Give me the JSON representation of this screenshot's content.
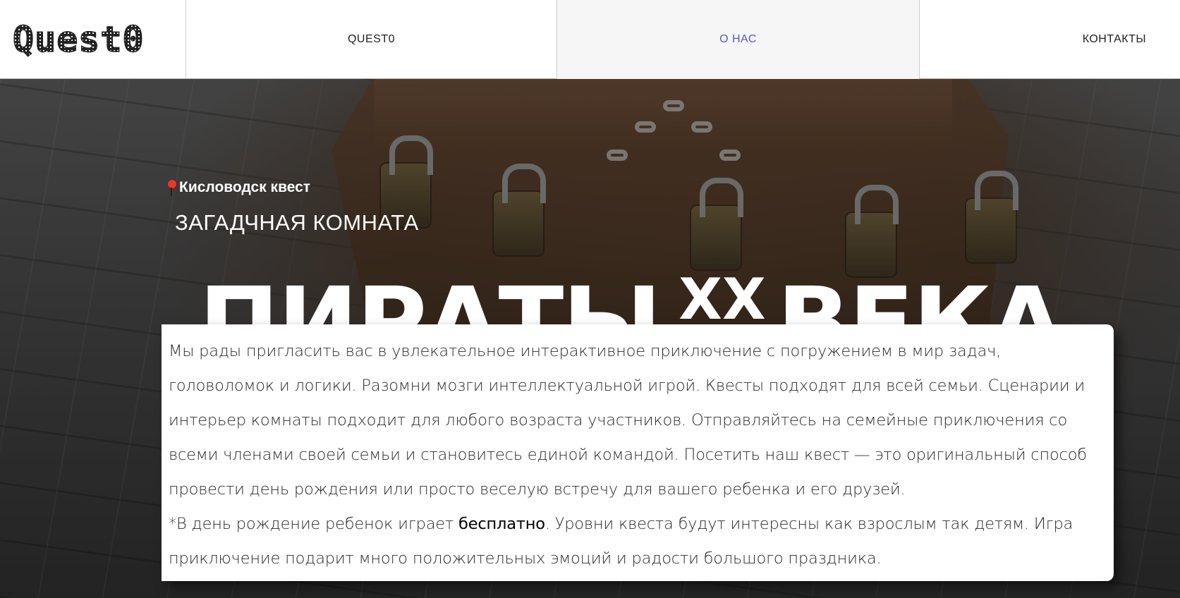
{
  "header": {
    "logo": "Quest0",
    "nav": [
      {
        "label": "QUEST0",
        "active": false
      },
      {
        "label": "О НАС",
        "active": true
      },
      {
        "label": "КОНТАКТЫ",
        "active": false
      }
    ],
    "active_color": "#5b57c9"
  },
  "hero": {
    "location": "Кисловодск квест",
    "subtitle": "ЗАГАДЧНАЯ КОМНАТА",
    "title_part1": "ПИРАТЫ",
    "title_sup": "XX",
    "title_part2": "ВЕКА"
  },
  "description": {
    "paragraph1": "Мы рады пригласить вас в увлекательное интерактивное приключение с погружением в мир задач, головоломок и логики. Разомни мозги интеллектуальной игрой. Квесты подходят для всей семьи. Сценарии и интерьер комнаты подходит для любого возраста участников. Отправляйтесь на семейные приключения со всеми членами своей семьи и становитесь единой командой. Посетить наш квест — это оригинальный способ провести день рождения или просто веселую встречу для вашего ребенка и его друзей.",
    "paragraph2_before": "*В день рождение ребенок играет ",
    "paragraph2_bold": "бесплатно",
    "paragraph2_after": ". Уровни квеста будут интересны как взрослым так детям. Игра приключение подарит много положительных эмоций и радости большого праздника."
  }
}
